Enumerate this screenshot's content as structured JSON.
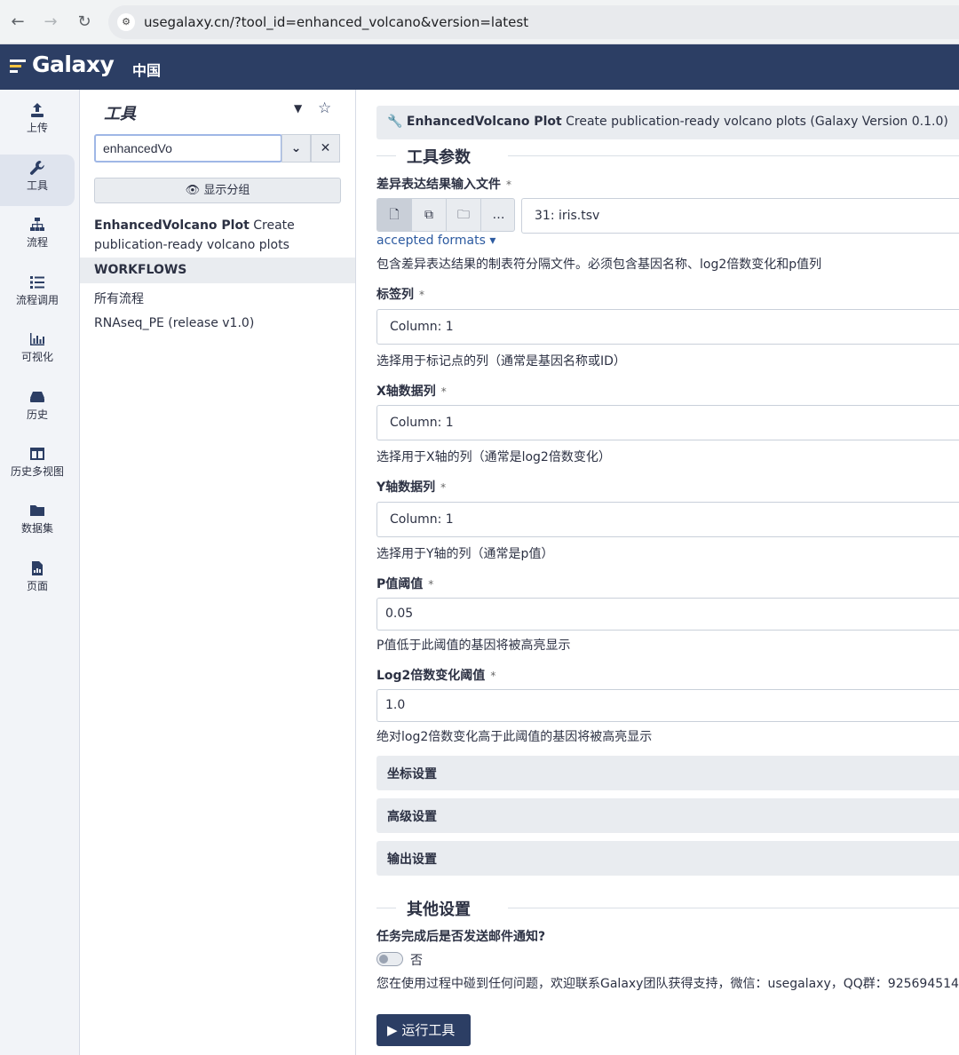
{
  "browser": {
    "url": "usegalaxy.cn/?tool_id=enhanced_volcano&version=latest"
  },
  "masthead": {
    "brand": "Galaxy",
    "subtitle": "中国"
  },
  "activity_bar": {
    "items": [
      {
        "label": "上传",
        "icon": "upload-icon"
      },
      {
        "label": "工具",
        "icon": "wrench-icon"
      },
      {
        "label": "流程",
        "icon": "sitemap-icon"
      },
      {
        "label": "流程调用",
        "icon": "list-icon"
      },
      {
        "label": "可视化",
        "icon": "chart-bar-icon"
      },
      {
        "label": "历史",
        "icon": "hdd-icon"
      },
      {
        "label": "历史多视图",
        "icon": "columns-icon"
      },
      {
        "label": "数据集",
        "icon": "folder-icon"
      },
      {
        "label": "页面",
        "icon": "file-chart-icon"
      }
    ]
  },
  "tool_panel": {
    "title": "工具",
    "search_value": "enhancedVo",
    "show_sections_label": "显示分组",
    "tool_result": {
      "name": "EnhancedVolcano Plot",
      "description": " Create publication-ready volcano plots"
    },
    "section_label": "WORKFLOWS",
    "workflows": [
      "所有流程",
      "RNAseq_PE (release v1.0)"
    ]
  },
  "tool_form": {
    "header_name": "EnhancedVolcano Plot",
    "header_desc": " Create publication-ready volcano plots (Galaxy Version 0.1.0)",
    "params_title": "工具参数",
    "required_mark": "*",
    "fields": {
      "input_file": {
        "label": "差异表达结果输入文件",
        "value": "31: iris.tsv",
        "accepted": "accepted formats ▾",
        "help": "包含差异表达结果的制表符分隔文件。必须包含基因名称、log2倍数变化和p值列"
      },
      "label_col": {
        "label": "标签列",
        "value": "Column: 1",
        "help": "选择用于标记点的列（通常是基因名称或ID）"
      },
      "x_col": {
        "label": "X轴数据列",
        "value": "Column: 1",
        "help": "选择用于X轴的列（通常是log2倍数变化）"
      },
      "y_col": {
        "label": "Y轴数据列",
        "value": "Column: 1",
        "help": "选择用于Y轴的列（通常是p值）"
      },
      "pval": {
        "label": "P值阈值",
        "value": "0.05",
        "help": "P值低于此阈值的基因将被高亮显示"
      },
      "fc": {
        "label": "Log2倍数变化阈值",
        "value": "1.0",
        "help": "绝对log2倍数变化高于此阈值的基因将被高亮显示"
      }
    },
    "sections": [
      "坐标设置",
      "高级设置",
      "输出设置"
    ],
    "other_title": "其他设置",
    "email_label": "任务完成后是否发送邮件通知?",
    "toggle_label": "否",
    "support_text": "您在使用过程中碰到任何问题，欢迎联系Galaxy团队获得支持，微信：usegalaxy，QQ群：925694514",
    "run_label": "运行工具"
  }
}
